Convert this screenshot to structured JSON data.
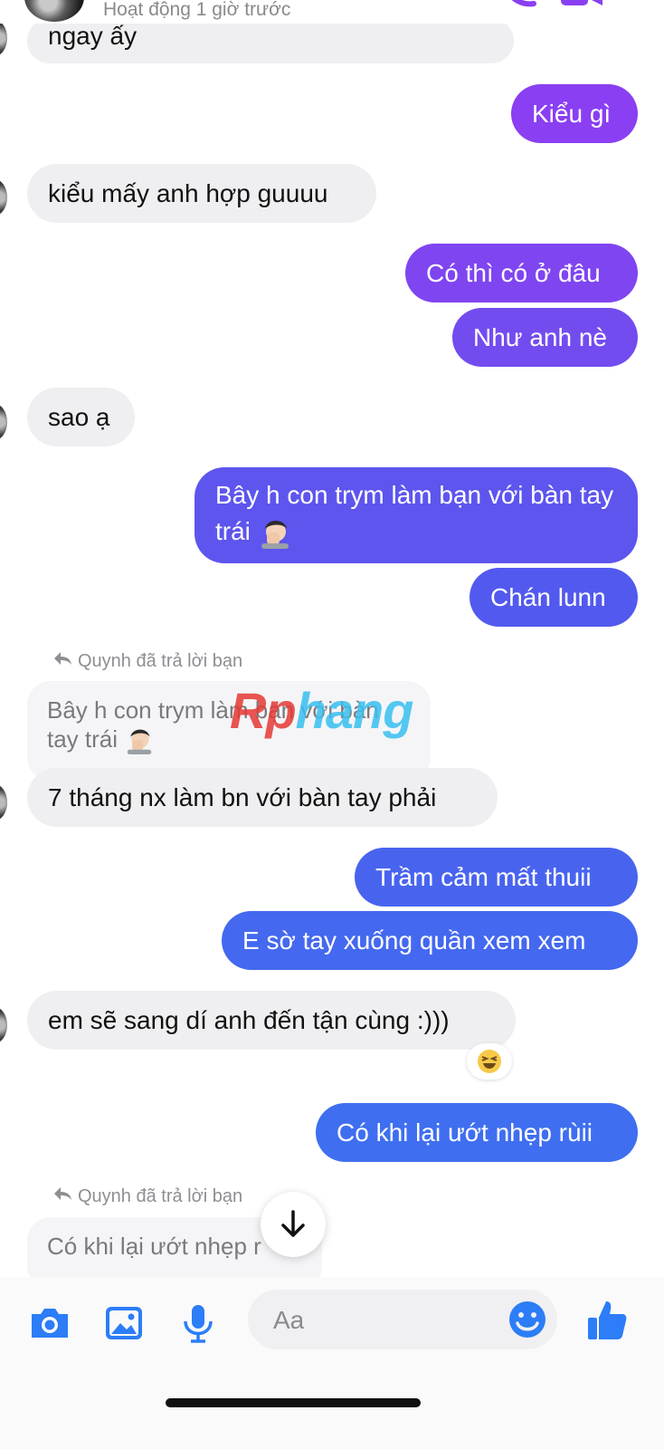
{
  "header": {
    "status": "Hoạt động 1 giờ trước"
  },
  "colors": {
    "outgoing_purple": "#8a3ff2",
    "outgoing_indigo": "#5b56ee",
    "outgoing_blue": "#3f6ff0",
    "incoming_bg": "#efeff1",
    "messenger_blue": "#2c7df7"
  },
  "messages": [
    {
      "side": "in",
      "text": "ngay ấy"
    },
    {
      "side": "out",
      "text": "Kiểu gì"
    },
    {
      "side": "in",
      "text": "kiểu mấy anh hợp guuuu"
    },
    {
      "side": "out",
      "text": "Có thì có ở đâu"
    },
    {
      "side": "out",
      "text": "Như anh nè"
    },
    {
      "side": "in",
      "text": "sao ạ"
    },
    {
      "side": "out",
      "text": "Bây h con trym làm bạn với bàn tay trái",
      "emoji": "face-palm"
    },
    {
      "side": "out",
      "text": "Chán lunn"
    },
    {
      "side": "in",
      "reply_note": "Quynh đã trả lời bạn",
      "quoted": "Bây h con trym làm bạn với bàn tay trái",
      "quoted_emoji": "face-palm",
      "text": "7 tháng nx làm bn với bàn tay phải"
    },
    {
      "side": "out",
      "text": "Trầm cảm mất thuii"
    },
    {
      "side": "out",
      "text": "E sờ tay xuống quần xem xem"
    },
    {
      "side": "in",
      "text": "em sẽ sang dí anh đến tận cùng :)))",
      "reaction": "laughing-squint-emoji"
    },
    {
      "side": "out",
      "text": "Có khi lại ướt nhẹp rùii"
    },
    {
      "side": "in",
      "reply_note": "Quynh đã trả lời bạn",
      "quoted": "Có khi lại ướt nhẹp r"
    }
  ],
  "watermark": {
    "part1": "Rp",
    "part2": "hang"
  },
  "composer": {
    "placeholder": "Aa",
    "icons": [
      "camera-icon",
      "image-icon",
      "microphone-icon",
      "emoji-icon",
      "thumbs-up-icon"
    ]
  }
}
